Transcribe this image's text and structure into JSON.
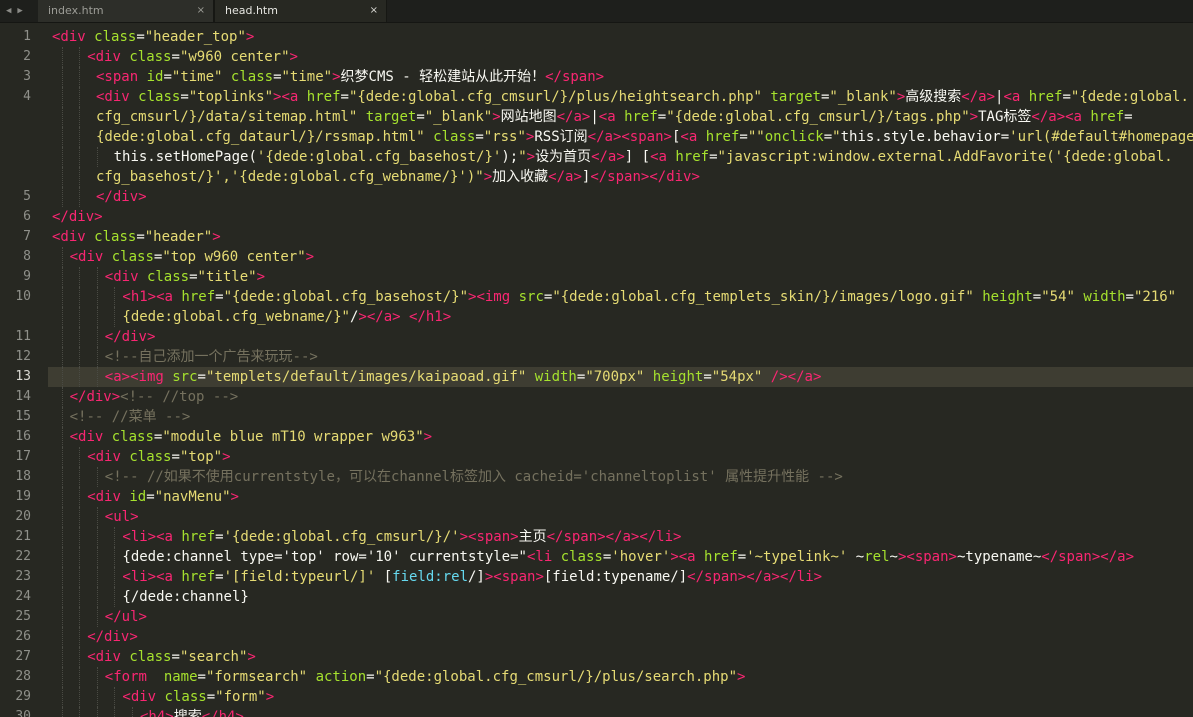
{
  "tabs": [
    {
      "label": "index.htm",
      "active": false
    },
    {
      "label": "head.htm",
      "active": true
    }
  ],
  "close_glyph": "×",
  "nav": {
    "back_glyph": "◀",
    "forward_glyph": "▶"
  },
  "current_line": 13,
  "colors": {
    "background": "#272822",
    "tag": "#f92672",
    "attribute": "#a6e22e",
    "string": "#e6db74",
    "text": "#f8f8f2",
    "comment": "#75715e",
    "keyword": "#66d9ef",
    "line_highlight": "#3e3d32"
  },
  "lines": [
    {
      "n": "1",
      "indent": 0,
      "tokens": [
        [
          "tg",
          "<div"
        ],
        [
          "tx",
          " "
        ],
        [
          "at",
          "class"
        ],
        [
          "tx",
          "="
        ],
        [
          "st",
          "\"header_top\""
        ],
        [
          "tg",
          ">"
        ]
      ]
    },
    {
      "n": "2",
      "indent": 2,
      "tokens": [
        [
          "tg",
          "<div"
        ],
        [
          "tx",
          " "
        ],
        [
          "at",
          "class"
        ],
        [
          "tx",
          "="
        ],
        [
          "st",
          "\"w960 center\""
        ],
        [
          "tg",
          ">"
        ]
      ]
    },
    {
      "n": "3",
      "indent": 2.5,
      "tokens": [
        [
          "tg",
          "<span"
        ],
        [
          "tx",
          " "
        ],
        [
          "at",
          "id"
        ],
        [
          "tx",
          "="
        ],
        [
          "st",
          "\"time\""
        ],
        [
          "tx",
          " "
        ],
        [
          "at",
          "class"
        ],
        [
          "tx",
          "="
        ],
        [
          "st",
          "\"time\""
        ],
        [
          "tg",
          ">"
        ],
        [
          "tx",
          "织梦CMS - 轻松建站从此开始！"
        ],
        [
          "tg",
          "</span>"
        ]
      ]
    },
    {
      "n": "4",
      "indent": 2.5,
      "tokens": [
        [
          "tg",
          "<div"
        ],
        [
          "tx",
          " "
        ],
        [
          "at",
          "class"
        ],
        [
          "tx",
          "="
        ],
        [
          "st",
          "\"toplinks\""
        ],
        [
          "tg",
          ">"
        ],
        [
          "tg",
          "<a"
        ],
        [
          "tx",
          " "
        ],
        [
          "at",
          "href"
        ],
        [
          "tx",
          "="
        ],
        [
          "st",
          "\"{dede:global.cfg_cmsurl/}/plus/heightsearch.php\""
        ],
        [
          "tx",
          " "
        ],
        [
          "at",
          "target"
        ],
        [
          "tx",
          "="
        ],
        [
          "st",
          "\"_blank\""
        ],
        [
          "tg",
          ">"
        ],
        [
          "tx",
          "高级搜索"
        ],
        [
          "tg",
          "</a>"
        ],
        [
          "tx",
          "|"
        ],
        [
          "tg",
          "<a"
        ],
        [
          "tx",
          " "
        ],
        [
          "at",
          "href"
        ],
        [
          "tx",
          "="
        ],
        [
          "st",
          "\"{dede:global."
        ]
      ]
    },
    {
      "n": "",
      "indent": 2.5,
      "tokens": [
        [
          "st",
          "cfg_cmsurl/}/data/sitemap.html\""
        ],
        [
          "tx",
          " "
        ],
        [
          "at",
          "target"
        ],
        [
          "tx",
          "="
        ],
        [
          "st",
          "\"_blank\""
        ],
        [
          "tg",
          ">"
        ],
        [
          "tx",
          "网站地图"
        ],
        [
          "tg",
          "</a>"
        ],
        [
          "tx",
          "|"
        ],
        [
          "tg",
          "<a"
        ],
        [
          "tx",
          " "
        ],
        [
          "at",
          "href"
        ],
        [
          "tx",
          "="
        ],
        [
          "st",
          "\"{dede:global.cfg_cmsurl/}/tags.php\""
        ],
        [
          "tg",
          ">"
        ],
        [
          "tx",
          "TAG标签"
        ],
        [
          "tg",
          "</a>"
        ],
        [
          "tg",
          "<a"
        ],
        [
          "tx",
          " "
        ],
        [
          "at",
          "href"
        ],
        [
          "tx",
          "="
        ]
      ]
    },
    {
      "n": "",
      "indent": 2.5,
      "tokens": [
        [
          "st",
          "{dede:global.cfg_dataurl/}/rssmap.html\""
        ],
        [
          "tx",
          " "
        ],
        [
          "at",
          "class"
        ],
        [
          "tx",
          "="
        ],
        [
          "st",
          "\"rss\""
        ],
        [
          "tg",
          ">"
        ],
        [
          "tx",
          "RSS订阅"
        ],
        [
          "tg",
          "</a>"
        ],
        [
          "tg",
          "<span>"
        ],
        [
          "tx",
          "["
        ],
        [
          "tg",
          "<a"
        ],
        [
          "tx",
          " "
        ],
        [
          "at",
          "href"
        ],
        [
          "tx",
          "="
        ],
        [
          "st",
          "\"\""
        ],
        [
          "at",
          "onclick"
        ],
        [
          "tx",
          "="
        ],
        [
          "st",
          "\""
        ],
        [
          "tx",
          "this.style.behavior="
        ],
        [
          "st",
          "'url(#default#homepage)'"
        ]
      ]
    },
    {
      "n": "",
      "indent": 3.5,
      "tokens": [
        [
          "tx",
          "this.setHomePage("
        ],
        [
          "st",
          "'{dede:global.cfg_basehost/}'"
        ],
        [
          "tx",
          ");"
        ],
        [
          "st",
          "\""
        ],
        [
          "tg",
          ">"
        ],
        [
          "tx",
          "设为首页"
        ],
        [
          "tg",
          "</a>"
        ],
        [
          "tx",
          "] ["
        ],
        [
          "tg",
          "<a"
        ],
        [
          "tx",
          " "
        ],
        [
          "at",
          "href"
        ],
        [
          "tx",
          "="
        ],
        [
          "st",
          "\"javascript:window.external.AddFavorite('{dede:global."
        ]
      ]
    },
    {
      "n": "",
      "indent": 2.5,
      "tokens": [
        [
          "st",
          "cfg_basehost/}','{dede:global.cfg_webname/}')\""
        ],
        [
          "tg",
          ">"
        ],
        [
          "tx",
          "加入收藏"
        ],
        [
          "tg",
          "</a>"
        ],
        [
          "tx",
          "]"
        ],
        [
          "tg",
          "</span>"
        ],
        [
          "tg",
          "</div>"
        ]
      ]
    },
    {
      "n": "5",
      "indent": 2.5,
      "tokens": [
        [
          "tg",
          "</div>"
        ]
      ]
    },
    {
      "n": "6",
      "indent": 0,
      "tokens": [
        [
          "tg",
          "</div>"
        ]
      ]
    },
    {
      "n": "7",
      "indent": 0,
      "tokens": [
        [
          "tg",
          "<div"
        ],
        [
          "tx",
          " "
        ],
        [
          "at",
          "class"
        ],
        [
          "tx",
          "="
        ],
        [
          "st",
          "\"header\""
        ],
        [
          "tg",
          ">"
        ]
      ]
    },
    {
      "n": "8",
      "indent": 1,
      "tokens": [
        [
          "tg",
          "<div"
        ],
        [
          "tx",
          " "
        ],
        [
          "at",
          "class"
        ],
        [
          "tx",
          "="
        ],
        [
          "st",
          "\"top w960 center\""
        ],
        [
          "tg",
          ">"
        ]
      ]
    },
    {
      "n": "9",
      "indent": 3,
      "tokens": [
        [
          "tg",
          "<div"
        ],
        [
          "tx",
          " "
        ],
        [
          "at",
          "class"
        ],
        [
          "tx",
          "="
        ],
        [
          "st",
          "\"title\""
        ],
        [
          "tg",
          ">"
        ]
      ]
    },
    {
      "n": "10",
      "indent": 4,
      "tokens": [
        [
          "tg",
          "<h1>"
        ],
        [
          "tg",
          "<a"
        ],
        [
          "tx",
          " "
        ],
        [
          "at",
          "href"
        ],
        [
          "tx",
          "="
        ],
        [
          "st",
          "\"{dede:global.cfg_basehost/}\""
        ],
        [
          "tg",
          ">"
        ],
        [
          "tg",
          "<img"
        ],
        [
          "tx",
          " "
        ],
        [
          "at",
          "src"
        ],
        [
          "tx",
          "="
        ],
        [
          "st",
          "\"{dede:global.cfg_templets_skin/}/images/logo.gif\""
        ],
        [
          "tx",
          " "
        ],
        [
          "at",
          "height"
        ],
        [
          "tx",
          "="
        ],
        [
          "st",
          "\"54\""
        ],
        [
          "tx",
          " "
        ],
        [
          "at",
          "width"
        ],
        [
          "tx",
          "="
        ],
        [
          "st",
          "\"216\""
        ]
      ]
    },
    {
      "n": "",
      "indent": 4,
      "tokens": [
        [
          "st",
          "{dede:global.cfg_webname/}\""
        ],
        [
          "tx",
          "/"
        ],
        [
          "tg",
          ">"
        ],
        [
          "tg",
          "</a>"
        ],
        [
          "tx",
          " "
        ],
        [
          "tg",
          "</h1>"
        ]
      ]
    },
    {
      "n": "11",
      "indent": 3,
      "tokens": [
        [
          "tg",
          "</div>"
        ]
      ]
    },
    {
      "n": "12",
      "indent": 3,
      "tokens": [
        [
          "cm",
          "<!--自己添加一个广告来玩玩-->"
        ]
      ]
    },
    {
      "n": "13",
      "indent": 3,
      "tokens": [
        [
          "tg",
          "<a>"
        ],
        [
          "tg",
          "<img"
        ],
        [
          "tx",
          " "
        ],
        [
          "at",
          "src"
        ],
        [
          "tx",
          "="
        ],
        [
          "st",
          "\"templets/default/images/kaipaoad.gif\""
        ],
        [
          "tx",
          " "
        ],
        [
          "at",
          "width"
        ],
        [
          "tx",
          "="
        ],
        [
          "st",
          "\"700px\""
        ],
        [
          "tx",
          " "
        ],
        [
          "at",
          "height"
        ],
        [
          "tx",
          "="
        ],
        [
          "st",
          "\"54px\""
        ],
        [
          "tx",
          " "
        ],
        [
          "tg",
          "/>"
        ],
        [
          "tg",
          "</a>"
        ]
      ]
    },
    {
      "n": "14",
      "indent": 1,
      "tokens": [
        [
          "tg",
          "</div>"
        ],
        [
          "cm",
          "<!-- //top -->"
        ]
      ]
    },
    {
      "n": "15",
      "indent": 1,
      "tokens": [
        [
          "cm",
          "<!-- //菜单 -->"
        ]
      ]
    },
    {
      "n": "16",
      "indent": 1,
      "tokens": [
        [
          "tg",
          "<div"
        ],
        [
          "tx",
          " "
        ],
        [
          "at",
          "class"
        ],
        [
          "tx",
          "="
        ],
        [
          "st",
          "\"module blue mT10 wrapper w963\""
        ],
        [
          "tg",
          ">"
        ]
      ]
    },
    {
      "n": "17",
      "indent": 2,
      "tokens": [
        [
          "tg",
          "<div"
        ],
        [
          "tx",
          " "
        ],
        [
          "at",
          "class"
        ],
        [
          "tx",
          "="
        ],
        [
          "st",
          "\"top\""
        ],
        [
          "tg",
          ">"
        ]
      ]
    },
    {
      "n": "18",
      "indent": 3,
      "tokens": [
        [
          "cm",
          "<!-- //如果不使用currentstyle，可以在channel标签加入 cacheid='channeltoplist' 属性提升性能 -->"
        ]
      ]
    },
    {
      "n": "19",
      "indent": 2,
      "tokens": [
        [
          "tg",
          "<div"
        ],
        [
          "tx",
          " "
        ],
        [
          "at",
          "id"
        ],
        [
          "tx",
          "="
        ],
        [
          "st",
          "\"navMenu\""
        ],
        [
          "tg",
          ">"
        ]
      ]
    },
    {
      "n": "20",
      "indent": 3,
      "tokens": [
        [
          "tg",
          "<ul>"
        ]
      ]
    },
    {
      "n": "21",
      "indent": 4,
      "tokens": [
        [
          "tg",
          "<li>"
        ],
        [
          "tg",
          "<a"
        ],
        [
          "tx",
          " "
        ],
        [
          "at",
          "href"
        ],
        [
          "tx",
          "="
        ],
        [
          "st",
          "'{dede:global.cfg_cmsurl/}/'"
        ],
        [
          "tg",
          ">"
        ],
        [
          "tg",
          "<span>"
        ],
        [
          "tx",
          "主页"
        ],
        [
          "tg",
          "</span>"
        ],
        [
          "tg",
          "</a>"
        ],
        [
          "tg",
          "</li>"
        ]
      ]
    },
    {
      "n": "22",
      "indent": 4,
      "tokens": [
        [
          "tx",
          "{dede:channel type='top' row='10' currentstyle=\""
        ],
        [
          "tg",
          "<li"
        ],
        [
          "tx",
          " "
        ],
        [
          "at",
          "class"
        ],
        [
          "tx",
          "="
        ],
        [
          "st",
          "'hover'"
        ],
        [
          "tg",
          ">"
        ],
        [
          "tg",
          "<a"
        ],
        [
          "tx",
          " "
        ],
        [
          "at",
          "href"
        ],
        [
          "tx",
          "="
        ],
        [
          "st",
          "'~typelink~'"
        ],
        [
          "tx",
          " ~"
        ],
        [
          "at",
          "rel"
        ],
        [
          "tx",
          "~"
        ],
        [
          "tg",
          ">"
        ],
        [
          "tg",
          "<span>"
        ],
        [
          "tx",
          "~typename~"
        ],
        [
          "tg",
          "</span>"
        ],
        [
          "tg",
          "</a>"
        ]
      ]
    },
    {
      "n": "23",
      "indent": 4,
      "tokens": [
        [
          "tg",
          "<li>"
        ],
        [
          "tg",
          "<a"
        ],
        [
          "tx",
          " "
        ],
        [
          "at",
          "href"
        ],
        [
          "tx",
          "="
        ],
        [
          "st",
          "'[field:typeurl/]'"
        ],
        [
          "tx",
          " ["
        ],
        [
          "kw",
          "field:rel"
        ],
        [
          "tx",
          "/]"
        ],
        [
          "tg",
          ">"
        ],
        [
          "tg",
          "<span>"
        ],
        [
          "tx",
          "[field:typename/]"
        ],
        [
          "tg",
          "</span>"
        ],
        [
          "tg",
          "</a>"
        ],
        [
          "tg",
          "</li>"
        ]
      ]
    },
    {
      "n": "24",
      "indent": 4,
      "tokens": [
        [
          "tx",
          "{/dede:channel}"
        ]
      ]
    },
    {
      "n": "25",
      "indent": 3,
      "tokens": [
        [
          "tg",
          "</ul>"
        ]
      ]
    },
    {
      "n": "26",
      "indent": 2,
      "tokens": [
        [
          "tg",
          "</div>"
        ]
      ]
    },
    {
      "n": "27",
      "indent": 2,
      "tokens": [
        [
          "tg",
          "<div"
        ],
        [
          "tx",
          " "
        ],
        [
          "at",
          "class"
        ],
        [
          "tx",
          "="
        ],
        [
          "st",
          "\"search\""
        ],
        [
          "tg",
          ">"
        ]
      ]
    },
    {
      "n": "28",
      "indent": 3,
      "tokens": [
        [
          "tg",
          "<form"
        ],
        [
          "tx",
          "  "
        ],
        [
          "at",
          "name"
        ],
        [
          "tx",
          "="
        ],
        [
          "st",
          "\"formsearch\""
        ],
        [
          "tx",
          " "
        ],
        [
          "at",
          "action"
        ],
        [
          "tx",
          "="
        ],
        [
          "st",
          "\"{dede:global.cfg_cmsurl/}/plus/search.php\""
        ],
        [
          "tg",
          ">"
        ]
      ]
    },
    {
      "n": "29",
      "indent": 4,
      "tokens": [
        [
          "tg",
          "<div"
        ],
        [
          "tx",
          " "
        ],
        [
          "at",
          "class"
        ],
        [
          "tx",
          "="
        ],
        [
          "st",
          "\"form\""
        ],
        [
          "tg",
          ">"
        ]
      ]
    },
    {
      "n": "30",
      "indent": 5,
      "tokens": [
        [
          "tg",
          "<h4>"
        ],
        [
          "tx",
          "搜索"
        ],
        [
          "tg",
          "</h4>"
        ]
      ]
    }
  ]
}
